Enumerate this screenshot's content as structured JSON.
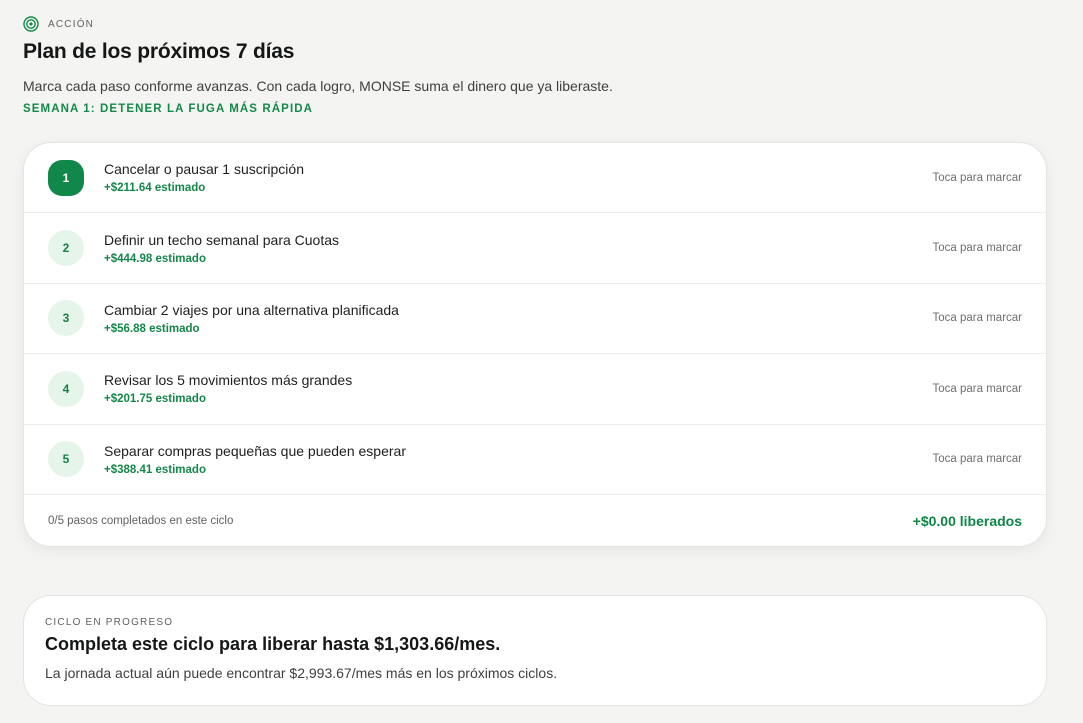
{
  "section": {
    "eyebrow": "ACCIÓN",
    "eyebrow_icon": "target-icon",
    "title": "Plan de los próximos 7 días",
    "subtitle": "Marca cada paso conforme avanzas. Con cada logro, MONSE suma el dinero que ya liberaste.",
    "week_label": "SEMANA 1: DETENER LA FUGA MÁS RÁPIDA"
  },
  "steps": [
    {
      "number": "1",
      "title": "Cancelar o pausar 1 suscripción",
      "amount": "+$211.64 estimado",
      "action": "Toca para marcar"
    },
    {
      "number": "2",
      "title": "Definir un techo semanal para Cuotas",
      "amount": "+$444.98 estimado",
      "action": "Toca para marcar"
    },
    {
      "number": "3",
      "title": "Cambiar 2 viajes por una alternativa planificada",
      "amount": "+$56.88 estimado",
      "action": "Toca para marcar"
    },
    {
      "number": "4",
      "title": "Revisar los 5 movimientos más grandes",
      "amount": "+$201.75 estimado",
      "action": "Toca para marcar"
    },
    {
      "number": "5",
      "title": "Separar compras pequeñas que pueden esperar",
      "amount": "+$388.41 estimado",
      "action": "Toca para marcar"
    }
  ],
  "footer": {
    "progress": "0/5 pasos completados en este ciclo",
    "freed": "+$0.00 liberados"
  },
  "cycle": {
    "eyebrow": "CICLO EN PROGRESO",
    "title": "Completa este ciclo para liberar hasta $1,303.66/mes.",
    "description": "La jornada actual aún puede encontrar $2,993.67/mes más en los próximos ciclos."
  },
  "colors": {
    "accent": "#11884a",
    "accent_light": "#e5f5ea",
    "background": "#f4f5f2"
  }
}
